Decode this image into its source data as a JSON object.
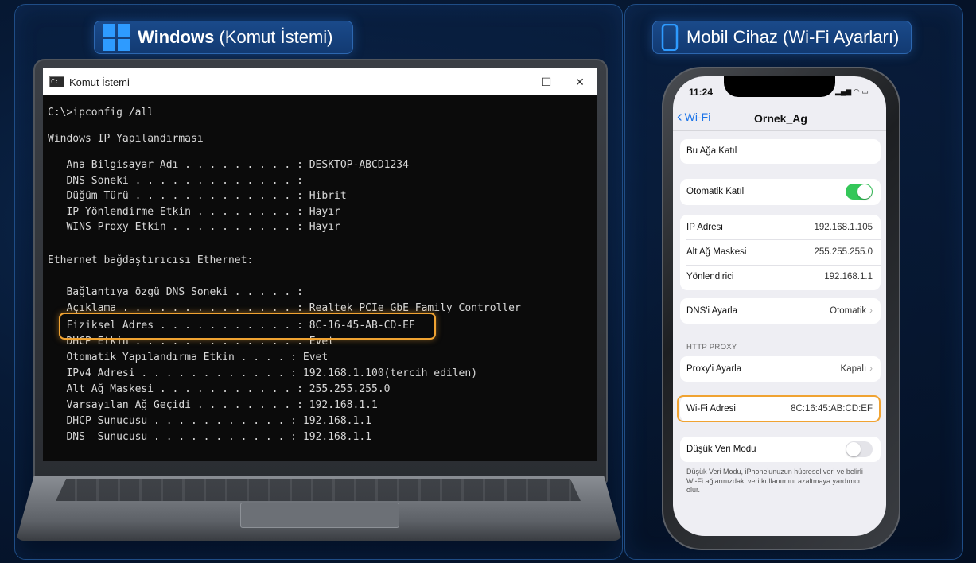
{
  "headings": {
    "left": {
      "bold": "Windows",
      "light": " (Komut İstemi)"
    },
    "right": {
      "text": "Mobil Cihaz (Wi-Fi Ayarları)"
    }
  },
  "cmd_window": {
    "title": "Komut İstemi",
    "min": "—",
    "max": "☐",
    "close": "✕",
    "lines": [
      "C:\\>ipconfig /all",
      "Windows IP Yapılandırması",
      "   Ana Bilgisayar Adı . . . . . . . . . : DESKTOP-ABCD1234",
      "   DNS Soneki . . . . . . . . . . . . . :",
      "   Düğüm Türü . . . . . . . . . . . . . : Hibrit",
      "   IP Yönlendirme Etkin . . . . . . . . : Hayır",
      "   WINS Proxy Etkin . . . . . . . . . . : Hayır",
      "Ethernet bağdaştırıcısı Ethernet:",
      "   Bağlantıya özgü DNS Soneki . . . . . :",
      "   Açıklama . . . . . . . . . . . . . . : Realtek PCIe GbE Family Controller",
      "   Fiziksel Adres . . . . . . . . . . . : 8C-16-45-AB-CD-EF",
      "   DHCP Etkin . . . . . . . . . . . . . : Evet",
      "   Otomatik Yapılandırma Etkin . . . . : Evet",
      "   IPv4 Adresi . . . . . . . . . . . . : 192.168.1.100(tercih edilen)",
      "   Alt Ağ Maskesi . . . . . . . . . . . : 255.255.255.0",
      "   Varsayılan Ağ Geçidi . . . . . . . . : 192.168.1.1",
      "   DHCP Sunucusu . . . . . . . . . . . : 192.168.1.1",
      "   DNS  Sunucusu . . . . . . . . . . . : 192.168.1.1"
    ]
  },
  "phone": {
    "time": "11:24",
    "status_icons": "▂▄▆ ◠ ▭",
    "back_label": "Wi-Fi",
    "network_name": "Ornek_Ag",
    "join_label": "Bu Ağa Katıl",
    "auto_join_label": "Otomatik Katıl",
    "auto_join_on": true,
    "ip_label": "IP Adresi",
    "ip_value": "192.168.1.105",
    "subnet_label": "Alt Ağ Maskesi",
    "subnet_value": "255.255.255.0",
    "router_label": "Yönlendirici",
    "router_value": "192.168.1.1",
    "dns_label": "DNS'i Ayarla",
    "dns_value": "Otomatik",
    "proxy_header": "HTTP PROXY",
    "proxy_label": "Proxy'i Ayarla",
    "proxy_value": "Kapalı",
    "wifi_addr_label": "Wi-Fi Adresi",
    "wifi_addr_value": "8C:16:45:AB:CD:EF",
    "low_data_label": "Düşük Veri Modu",
    "low_data_on": false,
    "low_data_desc": "Düşük Veri Modu, iPhone'unuzun hücresel veri ve belirli Wi-Fi ağlarınızdaki veri kullanımını azaltmaya yardımcı olur."
  },
  "colors": {
    "highlight": "#f0a332",
    "ios_blue": "#1a73e8",
    "toggle_on": "#34c759",
    "windows_blue": "#2e9bff"
  }
}
